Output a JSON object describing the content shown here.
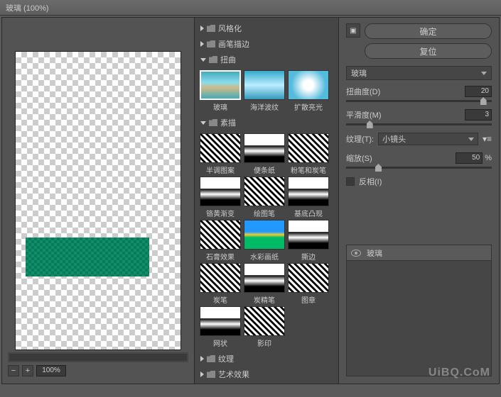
{
  "title": "玻璃 (100%)",
  "zoom": "100%",
  "categories": [
    {
      "label": "风格化",
      "open": false
    },
    {
      "label": "画笔描边",
      "open": false
    },
    {
      "label": "扭曲",
      "open": true,
      "thumbs": [
        {
          "label": "玻璃",
          "sel": true,
          "cls": "img-glass"
        },
        {
          "label": "海洋波纹",
          "cls": "img-ocean"
        },
        {
          "label": "扩散亮光",
          "cls": "img-diffuse"
        }
      ]
    },
    {
      "label": "素描",
      "open": true,
      "thumbs": [
        {
          "label": "半调图案",
          "cls": "img-sketch"
        },
        {
          "label": "便条纸",
          "cls": "img-sketch2"
        },
        {
          "label": "粉笔和炭笔",
          "cls": "img-sketch"
        },
        {
          "label": "铬黄渐变",
          "cls": "img-sketch2"
        },
        {
          "label": "绘图笔",
          "cls": "img-sketch"
        },
        {
          "label": "基底凸现",
          "cls": "img-sketch2"
        },
        {
          "label": "石膏效果",
          "cls": "img-sketch"
        },
        {
          "label": "水彩画纸",
          "cls": "img-color"
        },
        {
          "label": "撕边",
          "cls": "img-sketch2"
        },
        {
          "label": "炭笔",
          "cls": "img-sketch"
        },
        {
          "label": "炭精笔",
          "cls": "img-sketch2"
        },
        {
          "label": "图章",
          "cls": "img-sketch"
        },
        {
          "label": "网状",
          "cls": "img-sketch2"
        },
        {
          "label": "影印",
          "cls": "img-sketch"
        }
      ]
    },
    {
      "label": "纹理",
      "open": false
    },
    {
      "label": "艺术效果",
      "open": false
    }
  ],
  "buttons": {
    "ok": "确定",
    "reset": "复位"
  },
  "filter_dd": "玻璃",
  "sliders": {
    "distortion": {
      "label": "扭曲度(D)",
      "value": "20",
      "pos": 92
    },
    "smoothness": {
      "label": "平滑度(M)",
      "value": "3",
      "pos": 14
    },
    "scaling": {
      "label": "缩放(S)",
      "value": "50",
      "pos": 20,
      "suffix": "%"
    }
  },
  "texture": {
    "label": "纹理(T):",
    "value": "小镜头"
  },
  "invert": {
    "label": "反相(I)"
  },
  "layer": {
    "name": "玻璃"
  },
  "watermark": "UiBQ.CoM"
}
